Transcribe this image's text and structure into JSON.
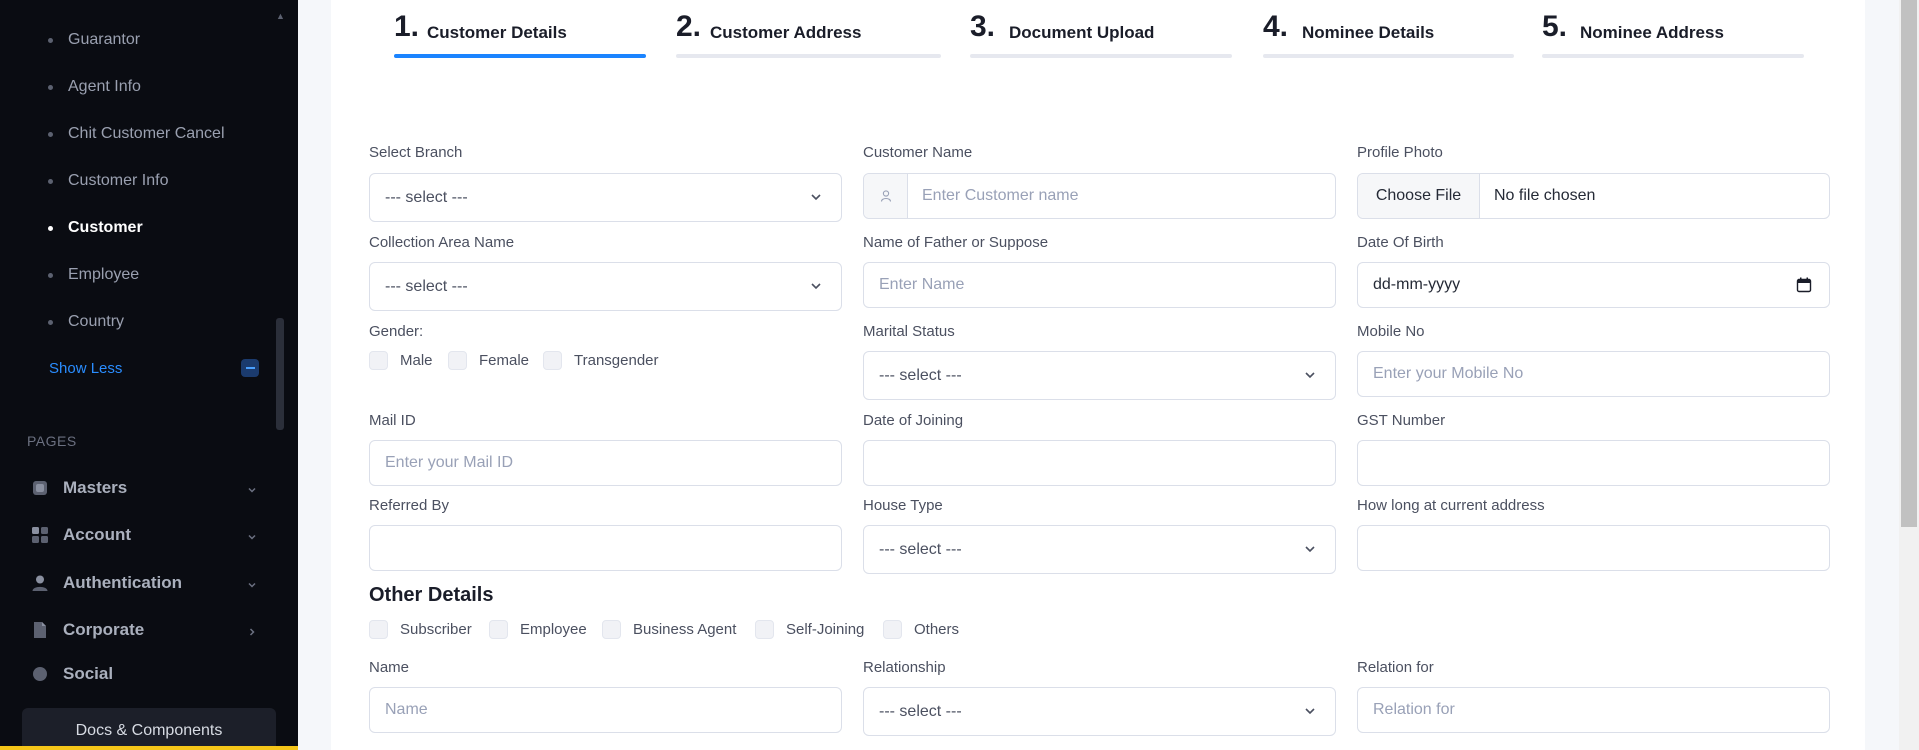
{
  "sidebar": {
    "sub_items": [
      {
        "label": "Guarantor",
        "active": false
      },
      {
        "label": "Agent Info",
        "active": false
      },
      {
        "label": "Chit Customer Cancel",
        "active": false
      },
      {
        "label": "Customer Info",
        "active": false
      },
      {
        "label": "Customer",
        "active": true
      },
      {
        "label": "Employee",
        "active": false
      },
      {
        "label": "Country",
        "active": false
      }
    ],
    "show_less": "Show Less",
    "pages_heading": "PAGES",
    "nav_items": [
      {
        "label": "Masters",
        "icon": "grid-icon",
        "chevron": "chevron-down-icon"
      },
      {
        "label": "Account",
        "icon": "apps-icon",
        "chevron": "chevron-down-icon"
      },
      {
        "label": "Authentication",
        "icon": "user-icon",
        "chevron": "chevron-down-icon"
      },
      {
        "label": "Corporate",
        "icon": "document-icon",
        "chevron": "chevron-right-icon"
      },
      {
        "label": "Social",
        "icon": "social-icon",
        "chevron": "chevron-down-icon"
      }
    ],
    "docs_button": "Docs & Components"
  },
  "steps": [
    {
      "number": "1.",
      "label": "Customer Details",
      "active": true
    },
    {
      "number": "2.",
      "label": "Customer Address",
      "active": false
    },
    {
      "number": "3.",
      "label": "Document Upload",
      "active": false
    },
    {
      "number": "4.",
      "label": "Nominee Details",
      "active": false
    },
    {
      "number": "5.",
      "label": "Nominee Address",
      "active": false
    }
  ],
  "form": {
    "select_branch": {
      "label": "Select Branch",
      "value": "--- select ---"
    },
    "customer_name": {
      "label": "Customer Name",
      "placeholder": "Enter Customer name"
    },
    "profile_photo": {
      "label": "Profile Photo",
      "button": "Choose File",
      "status": "No file chosen"
    },
    "collection_area": {
      "label": "Collection Area Name",
      "value": "--- select ---"
    },
    "father_name": {
      "label": "Name of Father or Suppose",
      "placeholder": "Enter Name"
    },
    "dob": {
      "label": "Date Of Birth",
      "value": "dd-mm-yyyy"
    },
    "gender": {
      "label": "Gender:",
      "options": [
        "Male",
        "Female",
        "Transgender"
      ]
    },
    "marital_status": {
      "label": "Marital Status",
      "value": "--- select ---"
    },
    "mobile": {
      "label": "Mobile No",
      "placeholder": "Enter your Mobile No"
    },
    "mail": {
      "label": "Mail ID",
      "placeholder": "Enter your Mail ID"
    },
    "joining_date": {
      "label": "Date of Joining",
      "value": ""
    },
    "gst": {
      "label": "GST Number",
      "value": ""
    },
    "referred_by": {
      "label": "Referred By",
      "value": ""
    },
    "house_type": {
      "label": "House Type",
      "value": "--- select ---"
    },
    "how_long": {
      "label": "How long at current address",
      "value": ""
    }
  },
  "other_details": {
    "title": "Other Details",
    "options": [
      "Subscriber",
      "Employee",
      "Business Agent",
      "Self-Joining",
      "Others"
    ],
    "name": {
      "label": "Name",
      "placeholder": "Name"
    },
    "relationship": {
      "label": "Relationship",
      "value": "--- select ---"
    },
    "relation_for": {
      "label": "Relation for",
      "placeholder": "Relation for"
    }
  },
  "colors": {
    "accent": "#1b84ff",
    "sidebar_bg": "#0a0c12",
    "page_bg": "#f5f7fa"
  }
}
